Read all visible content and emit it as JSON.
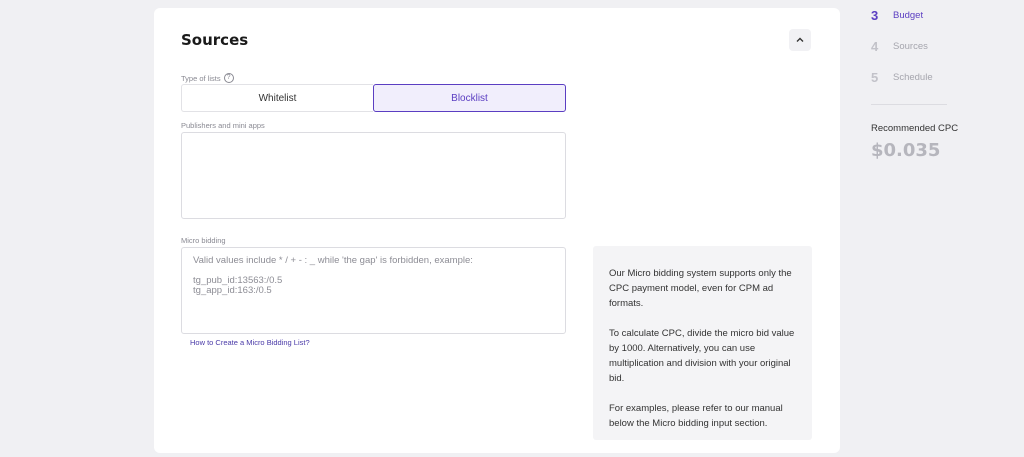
{
  "section": {
    "title": "Sources",
    "type_label": "Type of lists",
    "toggle": {
      "whitelist_label": "Whitelist",
      "blocklist_label": "Blocklist",
      "selected": "Blocklist"
    },
    "publishers_label": "Publishers and mini apps",
    "publishers_value": "",
    "micro_label": "Micro bidding",
    "micro_placeholder": "Valid values include * / + - : _ while 'the gap' is forbidden, example:\n\ntg_pub_id:13563:/0.5\ntg_app_id:163:/0.5",
    "help_link": "How to Create a Micro Bidding List?"
  },
  "info": {
    "p1": "Our Micro bidding system supports only the CPC payment model, even for CPM ad formats.",
    "p2": "To calculate CPC, divide the micro bid value by 1000. Alternatively, you can use multiplication and division with your original bid.",
    "p3": "For examples, please refer to our manual below the Micro bidding input section."
  },
  "steps": [
    {
      "num": "3",
      "label": "Budget",
      "state": "active"
    },
    {
      "num": "4",
      "label": "Sources",
      "state": "inactive"
    },
    {
      "num": "5",
      "label": "Schedule",
      "state": "inactive"
    }
  ],
  "recommended": {
    "label": "Recommended CPC",
    "value": "$0.035"
  },
  "colors": {
    "accent": "#5b3ec2",
    "accent_bg": "#f1eefc",
    "muted": "#b6b6bd"
  }
}
